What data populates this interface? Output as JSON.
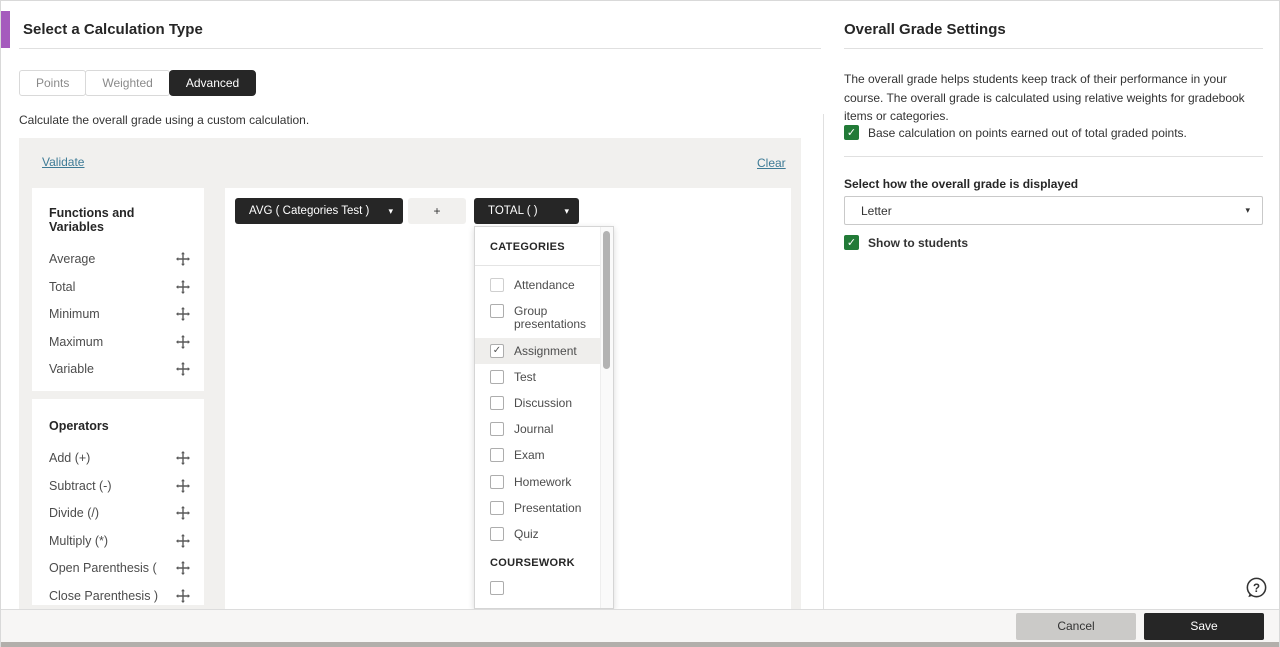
{
  "page": {
    "title": "Select a Calculation Type",
    "description": "Calculate the overall grade using a custom calculation.",
    "validate_link": "Validate",
    "clear_link": "Clear"
  },
  "tabs": [
    {
      "label": "Points",
      "active": false
    },
    {
      "label": "Weighted",
      "active": false
    },
    {
      "label": "Advanced",
      "active": true
    }
  ],
  "functions_panel": {
    "title": "Functions and Variables",
    "items": [
      "Average",
      "Total",
      "Minimum",
      "Maximum",
      "Variable"
    ]
  },
  "operators_panel": {
    "title": "Operators",
    "items": [
      "Add (+)",
      "Subtract (-)",
      "Divide (/)",
      "Multiply (*)",
      "Open Parenthesis (",
      "Close Parenthesis )"
    ]
  },
  "formula": {
    "chips": [
      {
        "label": "AVG ( Categories Test )",
        "type": "dropdown"
      },
      {
        "label": "+",
        "type": "operator"
      },
      {
        "label": "TOTAL ( )",
        "type": "dropdown"
      }
    ]
  },
  "category_dropdown": {
    "section_categories": "CATEGORIES",
    "items": [
      {
        "label": "Attendance",
        "checked": false
      },
      {
        "label": "Group presentations",
        "checked": false
      },
      {
        "label": "Assignment",
        "checked": true
      },
      {
        "label": "Test",
        "checked": false
      },
      {
        "label": "Discussion",
        "checked": false
      },
      {
        "label": "Journal",
        "checked": false
      },
      {
        "label": "Exam",
        "checked": false
      },
      {
        "label": "Homework",
        "checked": false
      },
      {
        "label": "Presentation",
        "checked": false
      },
      {
        "label": "Quiz",
        "checked": false
      }
    ],
    "section_coursework": "COURSEWORK"
  },
  "settings": {
    "title": "Overall Grade Settings",
    "description": "The overall grade helps students keep track of their performance in your course. The overall grade is calculated using relative weights for gradebook items or categories.",
    "base_calc_label": "Base calculation on points earned out of total graded points.",
    "base_calc_checked": true,
    "display_label": "Select how the overall grade is displayed",
    "display_value": "Letter",
    "show_to_students_label": "Show to students",
    "show_to_students_checked": true
  },
  "footer": {
    "cancel": "Cancel",
    "save": "Save"
  },
  "icons": {
    "caret_down": "▾",
    "check": "✓",
    "help": "?"
  },
  "colors": {
    "accent_purple": "#a55bbd",
    "chip_dark": "#262626",
    "checkbox_green": "#217a37",
    "link_blue": "#3e7b96",
    "panel_gray": "#f1f0ee"
  }
}
